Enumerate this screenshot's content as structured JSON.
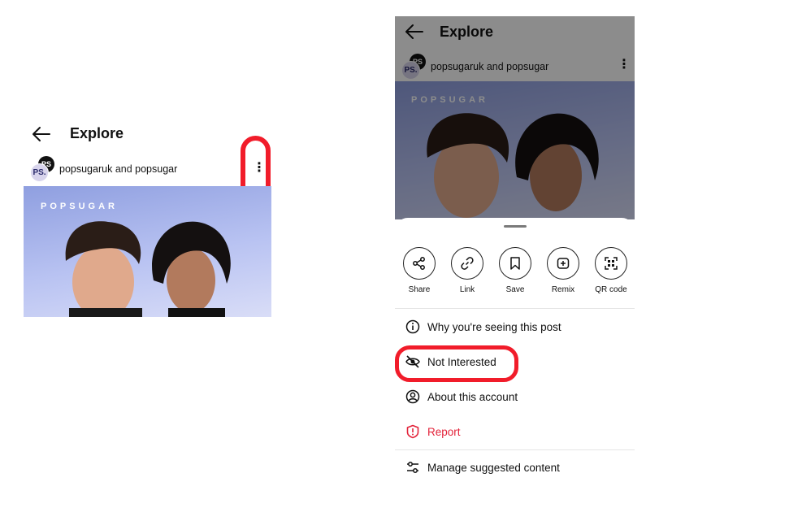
{
  "left": {
    "header": {
      "title": "Explore"
    },
    "post": {
      "account_a": "popsugaruk",
      "joiner": "and",
      "account_b": "popsugar",
      "brand": "POPSUGAR"
    },
    "avatar": {
      "top_initials": "PS",
      "bottom_initials": "PS."
    }
  },
  "right": {
    "header": {
      "title": "Explore"
    },
    "post": {
      "account_a": "popsugaruk",
      "joiner": "and",
      "account_b": "popsugar",
      "brand": "POPSUGAR"
    },
    "avatar": {
      "top_initials": "PS",
      "bottom_initials": "PS."
    },
    "actions": [
      {
        "label": "Share",
        "icon": "share-icon"
      },
      {
        "label": "Link",
        "icon": "link-icon"
      },
      {
        "label": "Save",
        "icon": "bookmark-icon"
      },
      {
        "label": "Remix",
        "icon": "remix-icon"
      },
      {
        "label": "QR code",
        "icon": "qr-code-icon"
      }
    ],
    "menu": [
      {
        "label": "Why you're seeing this post",
        "icon": "info-icon"
      },
      {
        "label": "Not Interested",
        "icon": "eye-off-icon"
      },
      {
        "label": "About this account",
        "icon": "account-icon"
      },
      {
        "label": "Report",
        "icon": "report-icon"
      },
      {
        "label": "Manage suggested content",
        "icon": "sliders-icon"
      }
    ]
  },
  "colors": {
    "highlight": "#f11c2a",
    "danger": "#e3243b",
    "brand_bg": "#a7b3ec"
  }
}
